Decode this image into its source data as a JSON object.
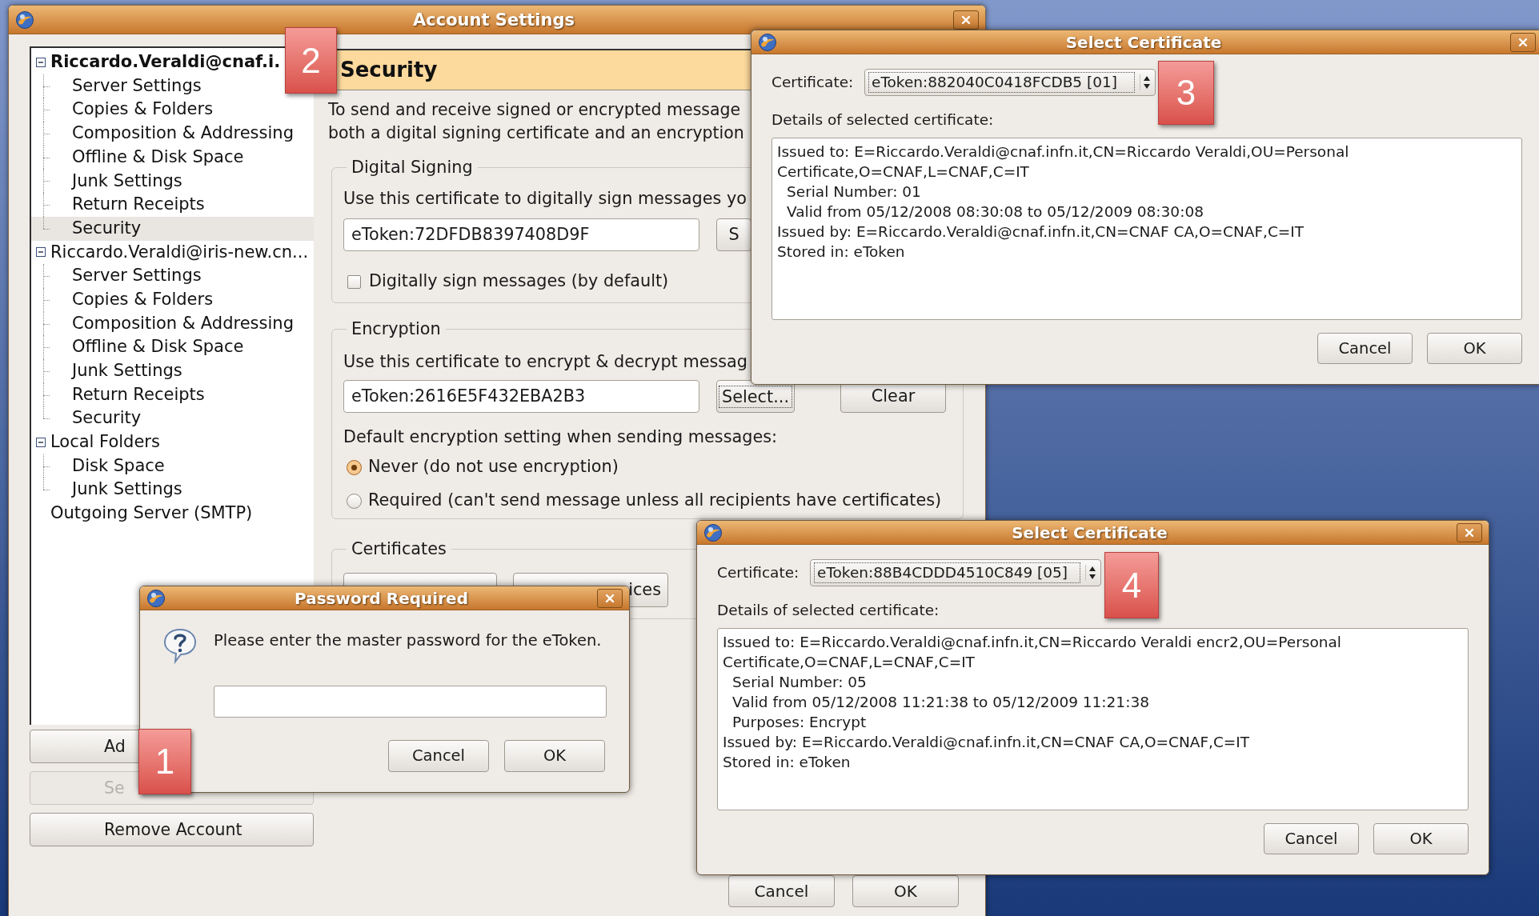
{
  "account_settings": {
    "title": "Account Settings",
    "tree": [
      {
        "label": "Riccardo.Veraldi@cnaf.i.",
        "kind": "account",
        "default": true,
        "expanded": true,
        "selected": false,
        "children": [
          {
            "label": "Server Settings",
            "selected": false
          },
          {
            "label": "Copies & Folders",
            "selected": false
          },
          {
            "label": "Composition & Addressing",
            "selected": false
          },
          {
            "label": "Offline & Disk Space",
            "selected": false
          },
          {
            "label": "Junk Settings",
            "selected": false
          },
          {
            "label": "Return Receipts",
            "selected": false
          },
          {
            "label": "Security",
            "selected": true
          }
        ]
      },
      {
        "label": "Riccardo.Veraldi@iris-new.cn...",
        "kind": "account",
        "default": false,
        "expanded": true,
        "selected": false,
        "children": [
          {
            "label": "Server Settings",
            "selected": false
          },
          {
            "label": "Copies & Folders",
            "selected": false
          },
          {
            "label": "Composition & Addressing",
            "selected": false
          },
          {
            "label": "Offline & Disk Space",
            "selected": false
          },
          {
            "label": "Junk Settings",
            "selected": false
          },
          {
            "label": "Return Receipts",
            "selected": false
          },
          {
            "label": "Security",
            "selected": false
          }
        ]
      },
      {
        "label": "Local Folders",
        "kind": "account",
        "default": false,
        "expanded": true,
        "selected": false,
        "children": [
          {
            "label": "Disk Space",
            "selected": false
          },
          {
            "label": "Junk Settings",
            "selected": false
          }
        ]
      },
      {
        "label": "Outgoing Server (SMTP)",
        "kind": "leaf",
        "default": false,
        "selected": false
      }
    ],
    "account_buttons": [
      {
        "label": "Ad",
        "disabled": false
      },
      {
        "label": "Se",
        "disabled": true
      },
      {
        "label": "Remove Account",
        "disabled": false
      }
    ],
    "page": {
      "heading": "Security",
      "intro": [
        "To send and receive signed or encrypted message",
        "both a digital signing certificate and an encryption"
      ],
      "signing": {
        "legend": "Digital Signing",
        "description": "Use this certificate to digitally sign messages yo",
        "certificate": "eToken:72DFDB8397408D9F",
        "buttons": [
          {
            "label": "S",
            "focused": false
          }
        ],
        "checkbox": {
          "label": "Digitally sign messages (by default)",
          "checked": false
        }
      },
      "encryption": {
        "legend": "Encryption",
        "description": "Use this certificate to encrypt & decrypt messag",
        "certificate": "eToken:2616E5F432EBA2B3",
        "buttons": [
          {
            "label": "Select...",
            "focused": true
          },
          {
            "label": "Clear",
            "focused": false
          }
        ],
        "setting_label": "Default encryption setting when sending messages:",
        "options": [
          {
            "label": "Never (do not use encryption)",
            "selected": true
          },
          {
            "label": "Required (can't send message unless all recipients have certificates)",
            "selected": false
          }
        ]
      },
      "certificates": {
        "legend": "Certificates",
        "buttons": [
          {
            "label": "ices"
          }
        ]
      }
    },
    "footer_buttons": [
      {
        "label": "Cancel"
      },
      {
        "label": "OK"
      }
    ]
  },
  "dialogs": [
    {
      "kind": "certificate",
      "title": "Select Certificate",
      "certificate_label": "Certificate:",
      "certificate": "eToken:882040C0418FCDB5 [01]",
      "details_label": "Details of selected certificate:",
      "details": [
        {
          "text": "Issued to: E=Riccardo.Veraldi@cnaf.infn.it,CN=Riccardo Veraldi,OU=Personal",
          "indented": false
        },
        {
          "text": "Certificate,O=CNAF,L=CNAF,C=IT",
          "indented": false
        },
        {
          "text": "Serial Number: 01",
          "indented": true
        },
        {
          "text": "Valid from 05/12/2008 08:30:08 to 05/12/2009 08:30:08",
          "indented": true
        },
        {
          "text": "Issued by: E=Riccardo.Veraldi@cnaf.infn.it,CN=CNAF CA,O=CNAF,C=IT",
          "indented": false
        },
        {
          "text": "Stored in: eToken",
          "indented": false
        }
      ],
      "buttons": [
        {
          "label": "Cancel"
        },
        {
          "label": "OK"
        }
      ]
    },
    {
      "kind": "certificate",
      "title": "Select Certificate",
      "certificate_label": "Certificate:",
      "certificate": "eToken:88B4CDDD4510C849 [05]",
      "details_label": "Details of selected certificate:",
      "details": [
        {
          "text": "Issued to: E=Riccardo.Veraldi@cnaf.infn.it,CN=Riccardo Veraldi encr2,OU=Personal",
          "indented": false
        },
        {
          "text": "Certificate,O=CNAF,L=CNAF,C=IT",
          "indented": false
        },
        {
          "text": "Serial Number: 05",
          "indented": true
        },
        {
          "text": "Valid from 05/12/2008 11:21:38 to 05/12/2009 11:21:38",
          "indented": true
        },
        {
          "text": "Purposes: Encrypt",
          "indented": true
        },
        {
          "text": "Issued by: E=Riccardo.Veraldi@cnaf.infn.it,CN=CNAF CA,O=CNAF,C=IT",
          "indented": false
        },
        {
          "text": "Stored in: eToken",
          "indented": false
        }
      ],
      "buttons": [
        {
          "label": "Cancel"
        },
        {
          "label": "OK"
        }
      ]
    },
    {
      "kind": "password",
      "title": "Password Required",
      "message": "Please enter the master password for the eToken.",
      "buttons": [
        {
          "label": "Cancel"
        },
        {
          "label": "OK"
        }
      ]
    }
  ],
  "callouts": [
    {
      "label": "1"
    },
    {
      "label": "2"
    },
    {
      "label": "3"
    },
    {
      "label": "4"
    }
  ]
}
